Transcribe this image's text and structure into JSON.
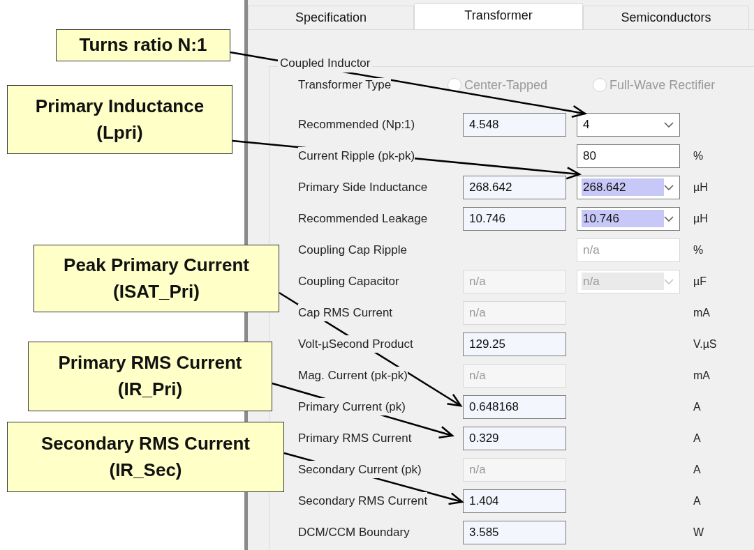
{
  "tabs": [
    {
      "label": "Specification",
      "selected": false
    },
    {
      "label": "Transformer",
      "selected": true
    },
    {
      "label": "Semiconductors",
      "selected": false
    }
  ],
  "group": {
    "title": "Coupled Inductor",
    "transformer_type": {
      "label": "Transformer Type",
      "options": [
        {
          "label": "Center-Tapped",
          "selected": false,
          "disabled": true
        },
        {
          "label": "Full-Wave Rectifier",
          "selected": false,
          "disabled": true
        }
      ]
    },
    "rows": [
      {
        "label": "Recommended (Np:1)",
        "field_1": {
          "value": "4.548",
          "disabled": false
        },
        "field_2": {
          "kind": "dropdown",
          "value": "4",
          "disabled": false,
          "highlighted": false
        }
      },
      {
        "label": "Current Ripple (pk-pk)",
        "field_2": {
          "kind": "text",
          "value": "80",
          "disabled": false
        },
        "unit": "%"
      },
      {
        "label": "Primary Side Inductance",
        "field_1": {
          "value": "268.642",
          "disabled": false
        },
        "field_2": {
          "kind": "dropdown",
          "value": "268.642",
          "disabled": false,
          "highlighted": true
        },
        "unit": "µH"
      },
      {
        "label": "Recommended Leakage",
        "field_1": {
          "value": "10.746",
          "disabled": false
        },
        "field_2": {
          "kind": "dropdown",
          "value": "10.746",
          "disabled": false,
          "highlighted": true
        },
        "unit": "µH"
      },
      {
        "label": "Coupling Cap Ripple",
        "field_2": {
          "kind": "text",
          "value": "n/a",
          "disabled": true
        },
        "unit": "%"
      },
      {
        "label": "Coupling Capacitor",
        "field_1": {
          "value": "n/a",
          "disabled": true
        },
        "field_2": {
          "kind": "dropdown",
          "value": "n/a",
          "disabled": true,
          "highlighted": false
        },
        "unit": "µF"
      },
      {
        "label": "Cap RMS Current",
        "field_1": {
          "value": "n/a",
          "disabled": true
        },
        "unit": "mA"
      },
      {
        "label": "Volt-µSecond Product",
        "field_1": {
          "value": "129.25",
          "disabled": false
        },
        "unit": "V.µS"
      },
      {
        "label": "Mag. Current (pk-pk)",
        "field_1": {
          "value": "n/a",
          "disabled": true
        },
        "unit": "mA"
      },
      {
        "label": "Primary Current (pk)",
        "field_1": {
          "value": "0.648168",
          "disabled": false
        },
        "unit": "A"
      },
      {
        "label": "Primary RMS Current",
        "field_1": {
          "value": "0.329",
          "disabled": false
        },
        "unit": "A"
      },
      {
        "label": "Secondary Current (pk)",
        "field_1": {
          "value": "n/a",
          "disabled": true
        },
        "unit": "A"
      },
      {
        "label": "Secondary RMS Current",
        "field_1": {
          "value": "1.404",
          "disabled": false
        },
        "unit": "A"
      },
      {
        "label": "DCM/CCM Boundary",
        "field_1": {
          "value": "3.585",
          "disabled": false
        },
        "unit": "W"
      }
    ]
  },
  "callouts": [
    {
      "lines": [
        "Turns ratio N:1"
      ]
    },
    {
      "lines": [
        "Primary Inductance",
        "(Lpri)"
      ]
    },
    {
      "lines": [
        "Peak Primary Current",
        "(ISAT_Pri)"
      ]
    },
    {
      "lines": [
        "Primary RMS Current",
        "(IR_Pri)"
      ]
    },
    {
      "lines": [
        "Secondary RMS Current",
        "(IR_Sec)"
      ]
    }
  ]
}
